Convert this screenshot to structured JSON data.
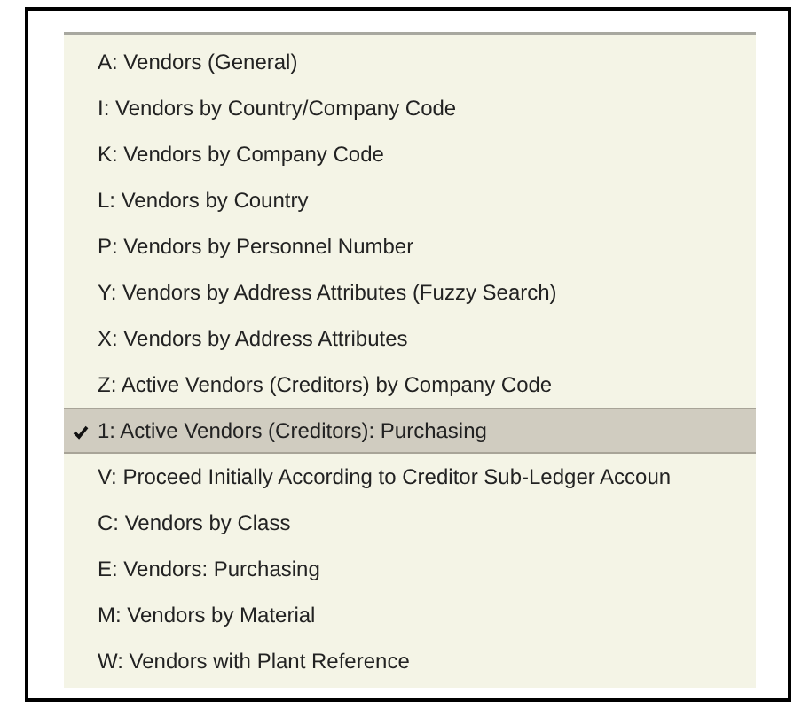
{
  "menu": {
    "items": [
      {
        "label": "A: Vendors (General)",
        "selected": false
      },
      {
        "label": "I: Vendors by Country/Company Code",
        "selected": false
      },
      {
        "label": "K: Vendors by Company Code",
        "selected": false
      },
      {
        "label": "L: Vendors by Country",
        "selected": false
      },
      {
        "label": "P: Vendors by Personnel Number",
        "selected": false
      },
      {
        "label": "Y: Vendors by Address Attributes (Fuzzy Search)",
        "selected": false
      },
      {
        "label": "X: Vendors by Address Attributes",
        "selected": false
      },
      {
        "label": "Z: Active Vendors (Creditors) by Company Code",
        "selected": false
      },
      {
        "label": "1: Active Vendors (Creditors): Purchasing",
        "selected": true
      },
      {
        "label": "V: Proceed Initially According to Creditor Sub-Ledger Accoun",
        "selected": false
      },
      {
        "label": "C: Vendors by Class",
        "selected": false
      },
      {
        "label": "E: Vendors: Purchasing",
        "selected": false
      },
      {
        "label": "M: Vendors by Material",
        "selected": false
      },
      {
        "label": "W: Vendors with Plant Reference",
        "selected": false
      }
    ]
  }
}
